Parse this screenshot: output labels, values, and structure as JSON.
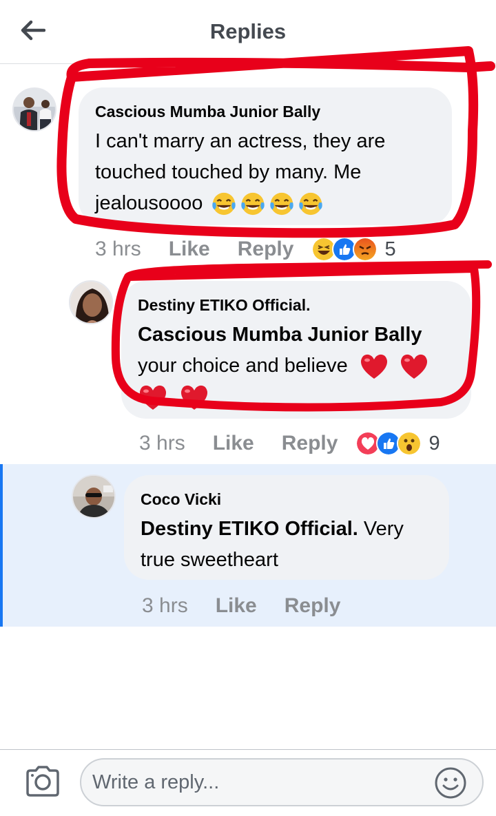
{
  "header": {
    "title": "Replies",
    "back_icon": "arrow-left-icon"
  },
  "comments": [
    {
      "author": "Cascious Mumba Junior Bally",
      "lines": [
        "I can't marry an actress, they are",
        "touched touched by many. Me",
        "jealousoooo"
      ],
      "emojis": [
        "tears-of-joy",
        "tears-of-joy",
        "tears-of-joy",
        "tears-of-joy"
      ],
      "time": "3 hrs",
      "like_label": "Like",
      "reply_label": "Reply",
      "reactions": [
        "haha",
        "like",
        "angry"
      ],
      "reaction_count": "5"
    },
    {
      "author": "Destiny ETIKO Official.",
      "mention": "Cascious Mumba Junior Bally",
      "text": "your choice and believe",
      "emojis": [
        "red-heart",
        "red-heart",
        "red-heart",
        "red-heart"
      ],
      "time": "3 hrs",
      "like_label": "Like",
      "reply_label": "Reply",
      "reactions": [
        "love",
        "like",
        "wow"
      ],
      "reaction_count": "9"
    },
    {
      "author": "Coco Vicki",
      "mention": "Destiny ETIKO Official.",
      "lines": [
        "Very",
        "true sweetheart"
      ],
      "time": "3 hrs",
      "like_label": "Like",
      "reply_label": "Reply"
    }
  ],
  "composer": {
    "placeholder": "Write a reply...",
    "camera_icon": "camera-icon",
    "emoji_icon": "smiley-icon"
  },
  "colors": {
    "annotation": "#e8001a",
    "highlight_bg": "#e7f0fc",
    "highlight_bar": "#1877f2",
    "bubble": "#f0f2f5"
  }
}
